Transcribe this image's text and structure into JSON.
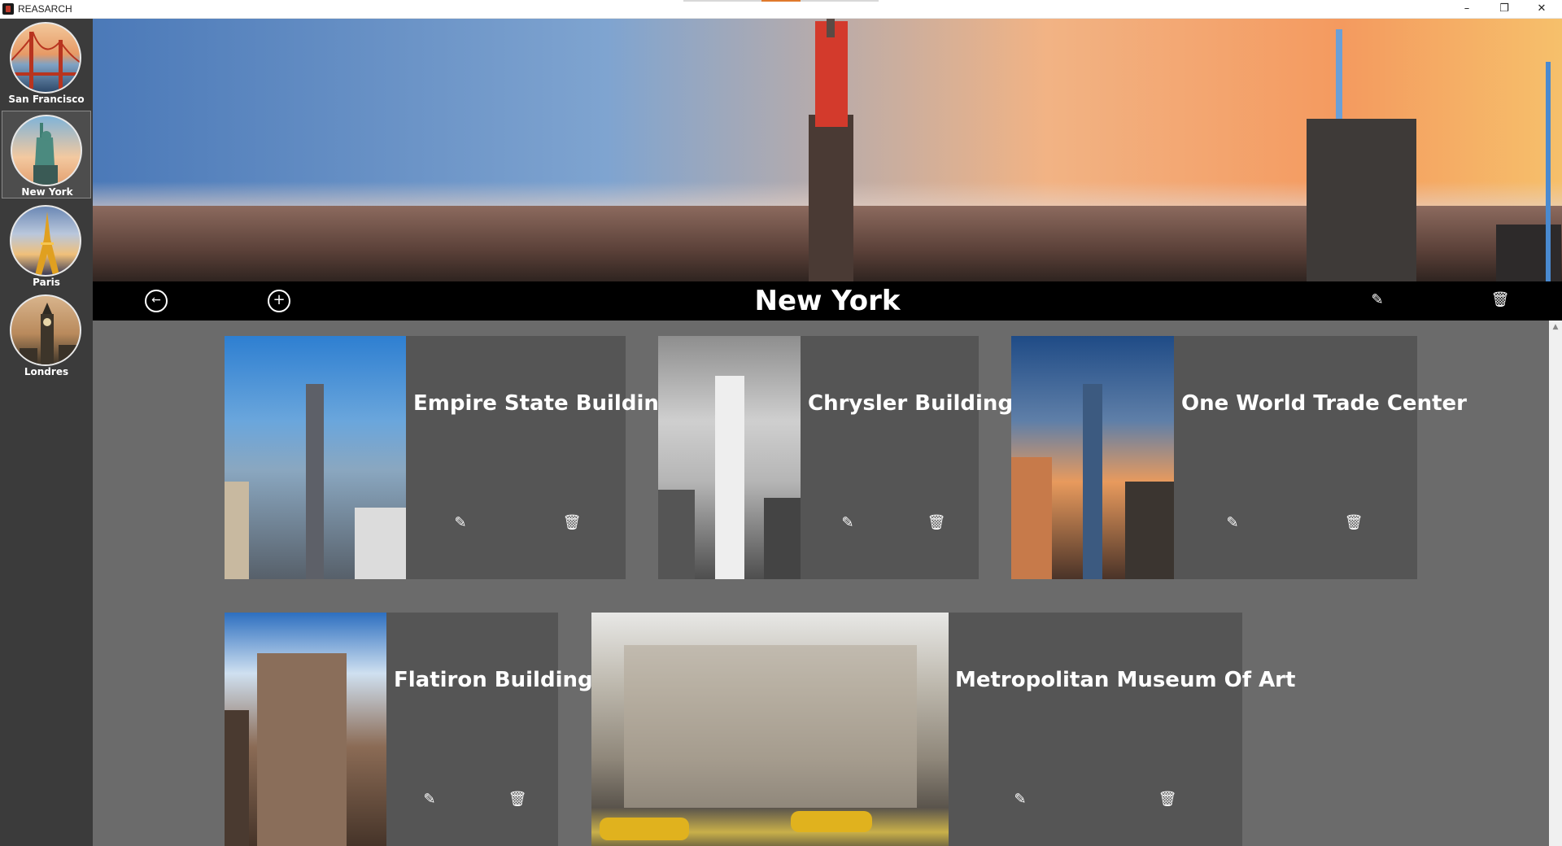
{
  "window": {
    "title": "REASARCH",
    "controls": {
      "minimize": "–",
      "maximize": "❐",
      "close": "✕"
    }
  },
  "sidebar": {
    "items": [
      {
        "label": "San Francisco",
        "icon": "golden-gate-icon",
        "selected": false
      },
      {
        "label": "New York",
        "icon": "statue-of-liberty-icon",
        "selected": true
      },
      {
        "label": "Paris",
        "icon": "eiffel-tower-icon",
        "selected": false
      },
      {
        "label": "Londres",
        "icon": "big-ben-icon",
        "selected": false
      }
    ]
  },
  "toolbar": {
    "title": "New York",
    "back_icon": "←",
    "add_icon": "+",
    "edit_icon": "✎",
    "delete_icon": "🗑"
  },
  "places": [
    {
      "title": "Empire State Building",
      "edit_icon": "✎",
      "delete_icon": "🗑"
    },
    {
      "title": "Chrysler Building",
      "edit_icon": "✎",
      "delete_icon": "🗑"
    },
    {
      "title": "One World Trade Center",
      "edit_icon": "✎",
      "delete_icon": "🗑"
    },
    {
      "title": "Flatiron Building",
      "edit_icon": "✎",
      "delete_icon": "🗑"
    },
    {
      "title": "Metropolitan Museum Of Art",
      "edit_icon": "✎",
      "delete_icon": "🗑"
    }
  ],
  "colors": {
    "sidebar_bg": "#3b3b3b",
    "toolbar_bg": "#000000",
    "content_bg": "#6b6b6b",
    "card_bg": "#555555"
  }
}
